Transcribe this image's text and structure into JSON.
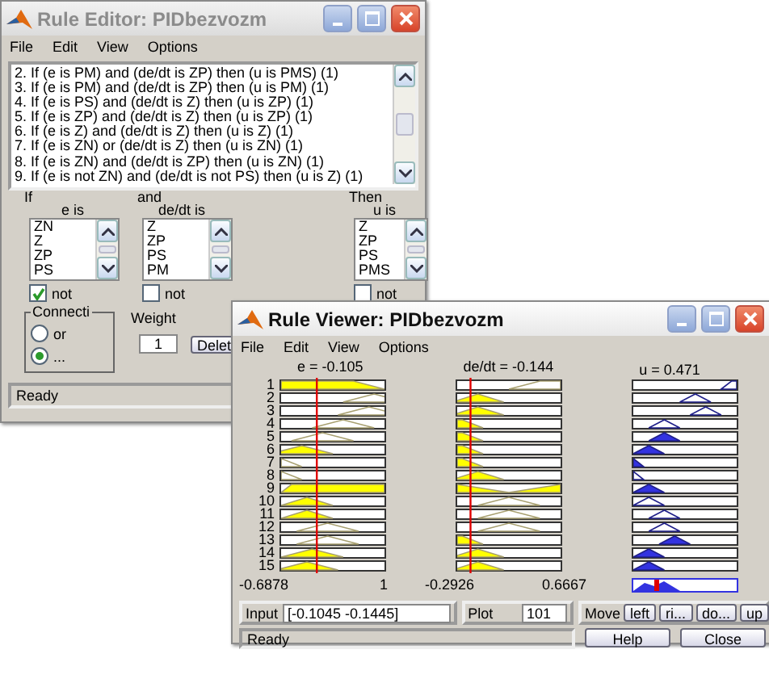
{
  "rule_editor": {
    "title": "Rule Editor: PIDbezvozm",
    "menu": [
      "File",
      "Edit",
      "View",
      "Options"
    ],
    "rules": [
      "2. If (e is PM) and (de/dt is ZP) then (u is PMS) (1)",
      "3. If (e is PM) and (de/dt is ZP) then (u is PM) (1)",
      "4. If (e is PS) and (de/dt is Z) then (u is ZP) (1)",
      "5. If (e is ZP) and (de/dt is Z) then (u is ZP) (1)",
      "6. If (e is Z) and (de/dt is Z) then (u is Z) (1)",
      "7. If (e is ZN) or (de/dt is Z) then (u is ZN) (1)",
      "8. If (e is ZN) and (de/dt is ZP) then (u is ZN) (1)",
      "9. If (e is not ZN) and (de/dt is not PS) then (u is Z) (1)"
    ],
    "columns": [
      {
        "prefix": "If",
        "label": "e is",
        "items": [
          "ZN",
          "Z",
          "ZP",
          "PS"
        ],
        "not": {
          "label": "not",
          "checked": true
        }
      },
      {
        "prefix": "and",
        "label": "de/dt is",
        "items": [
          "Z",
          "ZP",
          "PS",
          "PM"
        ],
        "not": {
          "label": "not",
          "checked": false
        }
      },
      {
        "prefix": "Then",
        "label": "u is",
        "items": [
          "Z",
          "ZP",
          "PS",
          "PMS"
        ],
        "not": {
          "label": "not",
          "checked": false
        }
      }
    ],
    "connection": {
      "label": "Connecti",
      "options": [
        {
          "label": "or",
          "selected": false
        },
        {
          "label": "...",
          "selected": true
        }
      ]
    },
    "weight": {
      "label": "Weight",
      "value": "1"
    },
    "delete_button": "Delet",
    "status": "Ready"
  },
  "rule_viewer": {
    "title": "Rule Viewer: PIDbezvozm",
    "menu": [
      "File",
      "Edit",
      "View",
      "Options"
    ],
    "variables": [
      {
        "label": "e = -0.105",
        "min": "-0.6878",
        "max": "1"
      },
      {
        "label": "de/dt = -0.144",
        "min": "-0.2926",
        "max": "0.6667"
      },
      {
        "label": "u = 0.471"
      }
    ],
    "rule_numbers": [
      "1",
      "2",
      "3",
      "4",
      "5",
      "6",
      "7",
      "8",
      "9",
      "10",
      "11",
      "12",
      "13",
      "14",
      "15"
    ],
    "input": {
      "label": "Input",
      "value": "[-0.1045 -0.1445]"
    },
    "plot": {
      "label": "Plot",
      "value": "101"
    },
    "move": {
      "label": "Move",
      "buttons": [
        "left",
        "ri...",
        "do...",
        "up"
      ]
    },
    "status": "Ready",
    "buttons": [
      "Help",
      "Close"
    ]
  }
}
